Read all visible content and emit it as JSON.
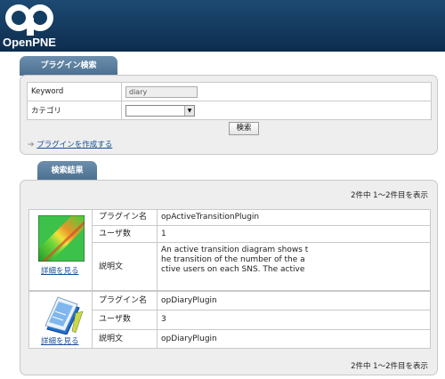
{
  "header": {
    "logo_text": "OpenPNE",
    "brand_color": "#123d63"
  },
  "search": {
    "tab_label": "プラグイン検索",
    "keyword_label": "Keyword",
    "keyword_value": "diary",
    "category_label": "カテゴリ",
    "category_value": "",
    "search_button": "検索",
    "create_link": "プラグインを作成する"
  },
  "results": {
    "tab_label": "検索結果",
    "summary_top": "2件中 1〜2件目を表示",
    "summary_bottom": "2件中 1〜2件目を表示",
    "plugins": [
      {
        "name_label": "プラグイン名",
        "name": "opActiveTransitionPlugin",
        "users_label": "ユーザ数",
        "users": "1",
        "desc_label": "説明文",
        "desc_line1": "An active transition diagram shows t",
        "desc_line2": "he transition of the number of the a",
        "desc_line3": "ctive users on each SNS. The active",
        "detail_link": "詳細を見る",
        "thumb_icon": "heatmap-thumbnail-icon"
      },
      {
        "name_label": "プラグイン名",
        "name": "opDiaryPlugin",
        "users_label": "ユーザ数",
        "users": "3",
        "desc_label": "説明文",
        "desc": "opDiaryPlugin",
        "detail_link": "詳細を見る",
        "thumb_icon": "diary-book-icon"
      }
    ]
  }
}
